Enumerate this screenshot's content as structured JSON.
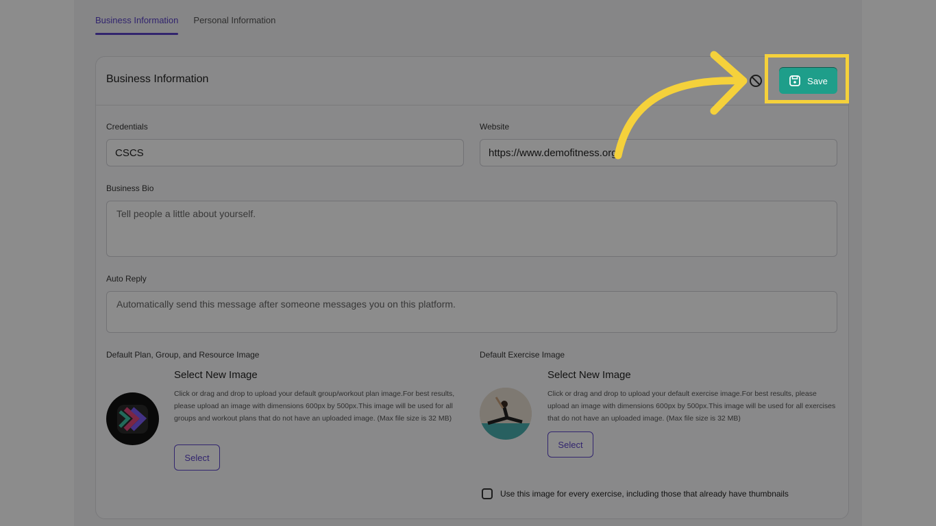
{
  "tabs": [
    {
      "label": "Business Information",
      "active": true
    },
    {
      "label": "Personal Information",
      "active": false
    }
  ],
  "card": {
    "title": "Business Information",
    "save_label": "Save",
    "cancel_icon": "ban-icon",
    "save_icon": "floppy-disk-icon"
  },
  "fields": {
    "credentials": {
      "label": "Credentials",
      "value": "CSCS"
    },
    "website": {
      "label": "Website",
      "value": "https://www.demofitness.org"
    },
    "bio": {
      "label": "Business Bio",
      "placeholder": "Tell people a little about yourself."
    },
    "auto_reply": {
      "label": "Auto Reply",
      "placeholder": "Automatically send this message after someone messages you on this platform."
    }
  },
  "images": {
    "plan": {
      "label": "Default Plan, Group, and Resource Image",
      "title": "Select New Image",
      "description": "Click or drag and drop to upload your default group/workout plan image.For best results, please upload an image with dimensions 600px by 500px.This image will be used for all groups and workout plans that do not have an uploaded image. (Max file size is 32 MB)",
      "button": "Select"
    },
    "exercise": {
      "label": "Default Exercise Image",
      "title": "Select New Image",
      "description": "Click or drag and drop to upload your default exercise image.For best results, please upload an image with dimensions 600px by 500px.This image will be used for all exercises that do not have an uploaded image. (Max file size is 32 MB)",
      "button": "Select"
    }
  },
  "checkbox": {
    "label": "Use this image for every exercise, including those that already have thumbnails",
    "checked": false
  },
  "colors": {
    "accent": "#5a43c8",
    "save": "#1e9e8a",
    "highlight": "#f5d13b"
  }
}
